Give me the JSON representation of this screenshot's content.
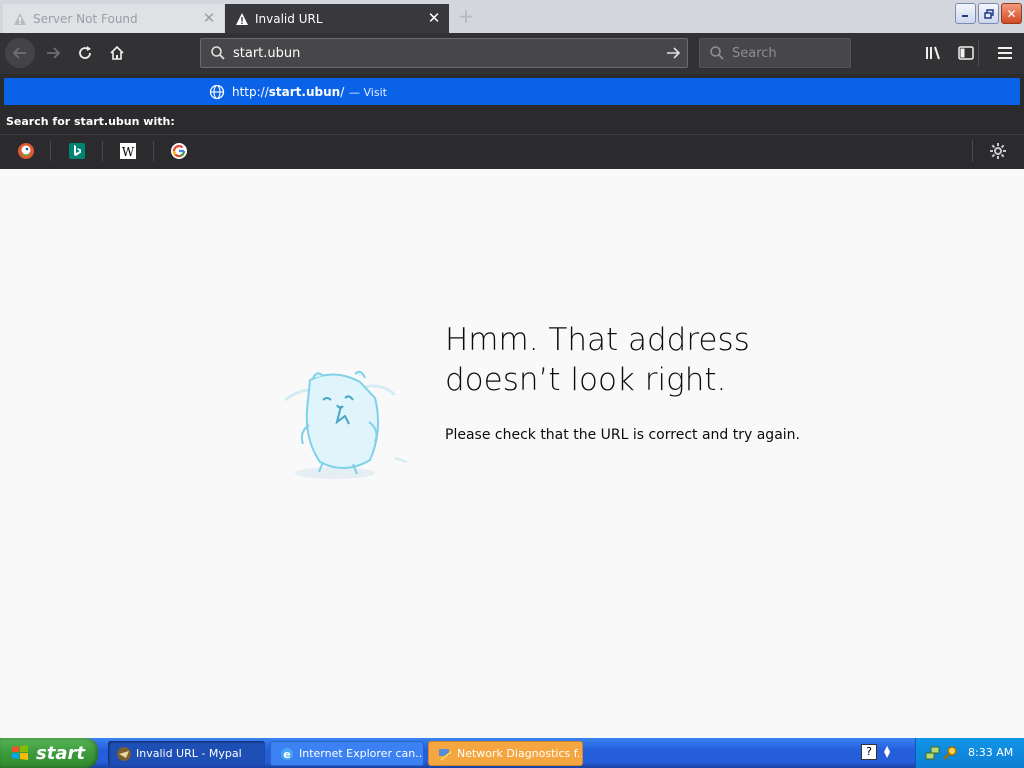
{
  "tabs": [
    {
      "title": "Server Not Found",
      "active": false
    },
    {
      "title": "Invalid URL",
      "active": true
    }
  ],
  "toolbar": {
    "url_value": "start.ubun",
    "search_placeholder": "Search"
  },
  "autocomplete": {
    "url_prefix": "http://",
    "url_bold": "start.ubun",
    "url_suffix": "/",
    "action": "— Visit",
    "search_for": "Search for start.ubun with:",
    "engines": [
      "duckduckgo-icon",
      "bing-icon",
      "wikipedia-icon",
      "google-icon"
    ]
  },
  "error_page": {
    "title_line1": "Hmm. That address",
    "title_line2": "doesn’t look right.",
    "description": "Please check that the URL is correct and try again."
  },
  "taskbar": {
    "start_label": "start",
    "items": [
      {
        "label": "Invalid URL - Mypal",
        "state": "active"
      },
      {
        "label": "Internet Explorer can...",
        "state": "normal"
      },
      {
        "label": "Network Diagnostics f...",
        "state": "flash"
      }
    ],
    "clock": "8:33 AM"
  },
  "colors": {
    "accent": "#0a62e8",
    "toolbar": "#323234",
    "taskbar": "#245edb"
  }
}
